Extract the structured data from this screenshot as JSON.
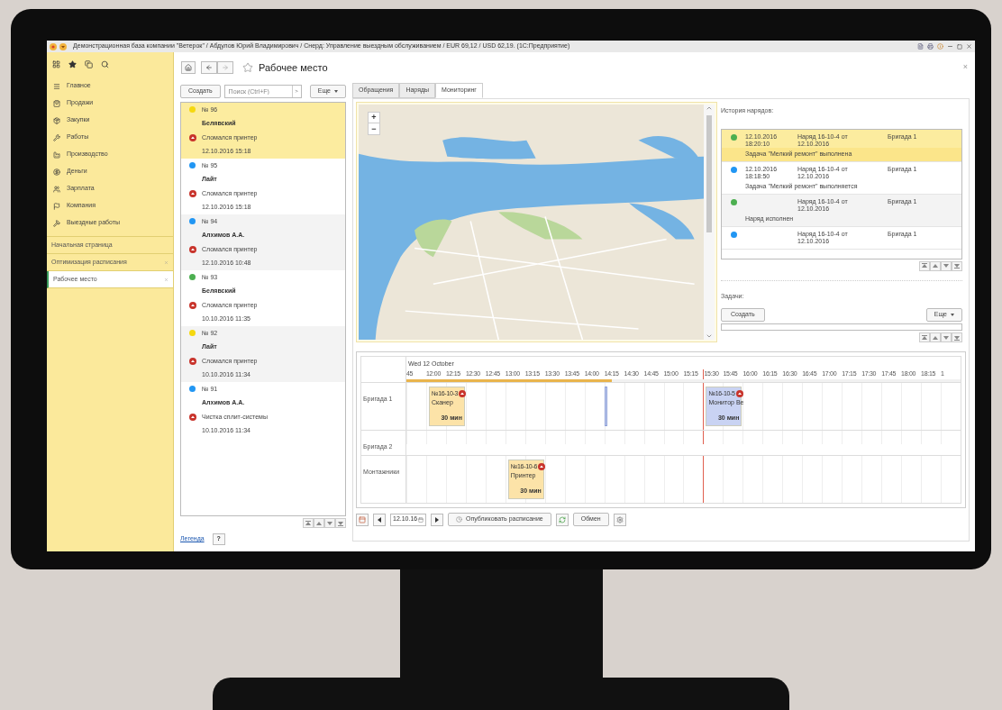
{
  "window": {
    "title": "Демонстрационная база компании \"Ветерок\" / Абдулов Юрий Владимирович / Снерд: Управление выездным обслуживанием / EUR 69,12 / USD 62,19. (1С:Предприятие)"
  },
  "sidebar": {
    "items": [
      {
        "label": "Главное"
      },
      {
        "label": "Продажи"
      },
      {
        "label": "Закупки"
      },
      {
        "label": "Работы"
      },
      {
        "label": "Производство"
      },
      {
        "label": "Деньги"
      },
      {
        "label": "Зарплата"
      },
      {
        "label": "Компания"
      },
      {
        "label": "Выездные работы"
      }
    ],
    "open_pages": [
      {
        "label": "Начальная страница",
        "selected": false,
        "closable": false
      },
      {
        "label": "Оптимизация расписания",
        "selected": false,
        "closable": true
      },
      {
        "label": "Рабочее место",
        "selected": true,
        "closable": true
      }
    ]
  },
  "header": {
    "title": "Рабочее место",
    "close": "×"
  },
  "requests": {
    "create_button": "Создать",
    "search": {
      "placeholder": "Поиск (Ctrl+F)"
    },
    "search_go": ">",
    "more_button": "Еще",
    "items": [
      {
        "number": "№ 96",
        "client": "Белявский",
        "problem": "Сломался принтер",
        "date": "12.10.2016 15:18",
        "color": "#f5d80f",
        "selected": true
      },
      {
        "number": "№ 95",
        "client": "Лайт",
        "problem": "Сломался принтер",
        "date": "12.10.2016 15:18",
        "color": "#2196f3",
        "selected": false
      },
      {
        "number": "№ 94",
        "client": "Алхимов А.А.",
        "problem": "Сломался принтер",
        "date": "12.10.2016 10:48",
        "color": "#2196f3",
        "selected": false
      },
      {
        "number": "№ 93",
        "client": "Белявский",
        "problem": "Сломался принтер",
        "date": "10.10.2016 11:35",
        "color": "#4caf50",
        "selected": false
      },
      {
        "number": "№ 92",
        "client": "Лайт",
        "problem": "Сломался принтер",
        "date": "10.10.2016 11:34",
        "color": "#f5d80f",
        "selected": false
      },
      {
        "number": "№ 91",
        "client": "Алхимов А.А.",
        "problem": "Чистка сплит-системы",
        "date": "10.10.2016 11:34",
        "color": "#2196f3",
        "selected": false
      }
    ],
    "legend_link": "Легенда",
    "help_button": "?"
  },
  "tabs": [
    {
      "label": "Обращения",
      "selected": false
    },
    {
      "label": "Наряды",
      "selected": false
    },
    {
      "label": "Мониторинг",
      "selected": true
    }
  ],
  "map": {
    "zoom_in": "+",
    "zoom_out": "−"
  },
  "history": {
    "label": "История нарядов:",
    "rows": [
      {
        "date": "12.10.2016",
        "time": "18:20:10",
        "order": "Наряд 16-10-4 от",
        "order_date": "12.10.2016",
        "team": "Бригада 1",
        "note": "Задача \"Мелкий ремонт\" выполнена",
        "color": "#4caf50",
        "selected": true
      },
      {
        "date": "12.10.2016",
        "time": "18:18:50",
        "order": "Наряд 16-10-4 от",
        "order_date": "12.10.2016",
        "team": "Бригада 1",
        "note": "Задача \"Мелкий ремонт\" выполняется",
        "color": "#2196f3",
        "selected": false
      },
      {
        "order": "Наряд 16-10-4 от",
        "order_date": "12.10.2016",
        "team": "Бригада 1",
        "note": "Наряд исполнен",
        "color": "#4caf50",
        "selected": false
      },
      {
        "order": "Наряд 16-10-4 от",
        "order_date": "12.10.2016",
        "team": "Бригада 1",
        "color": "#2196f3",
        "selected": false
      }
    ]
  },
  "tasks": {
    "label": "Задачи:",
    "create_button": "Создать",
    "more_button": "Еще"
  },
  "timeline": {
    "date": "Wed 12 October",
    "progress": {
      "level": 0.37
    },
    "ticks": [
      {
        "label": "45",
        "now": false
      },
      {
        "label": "12:00",
        "now": false
      },
      {
        "label": "12:15",
        "now": false
      },
      {
        "label": "12:30",
        "now": false
      },
      {
        "label": "12:45",
        "now": false
      },
      {
        "label": "13:00",
        "now": false
      },
      {
        "label": "13:15",
        "now": false
      },
      {
        "label": "13:30",
        "now": false
      },
      {
        "label": "13:45",
        "now": false
      },
      {
        "label": "14:00",
        "now": false
      },
      {
        "label": "14:15",
        "now": false
      },
      {
        "label": "14:30",
        "now": false
      },
      {
        "label": "14:45",
        "now": false
      },
      {
        "label": "15:00",
        "now": false
      },
      {
        "label": "15:15",
        "now": false
      },
      {
        "label": "15:30",
        "now": true
      },
      {
        "label": "15:45",
        "now": false
      },
      {
        "label": "16:00",
        "now": false
      },
      {
        "label": "16:15",
        "now": false
      },
      {
        "label": "16:30",
        "now": false
      },
      {
        "label": "16:45",
        "now": false
      },
      {
        "label": "17:00",
        "now": false
      },
      {
        "label": "17:15",
        "now": false
      },
      {
        "label": "17:30",
        "now": false
      },
      {
        "label": "17:45",
        "now": false
      },
      {
        "label": "18:00",
        "now": false
      },
      {
        "label": "18:15",
        "now": false
      },
      {
        "label": "1",
        "now": false
      }
    ],
    "rows": [
      {
        "name": "Бригада 1",
        "slots": [
          {
            "kind": "empty"
          },
          {
            "kind": "order",
            "number": "№16-10-3",
            "title": "Сканер",
            "duration": "30 мин",
            "color": "#fce3a8"
          },
          {
            "kind": "empty"
          },
          {
            "kind": "empty"
          },
          {
            "kind": "empty"
          },
          {
            "kind": "empty"
          },
          {
            "kind": "empty"
          },
          {
            "kind": "empty"
          },
          {
            "kind": "empty"
          },
          {
            "kind": "empty"
          },
          {
            "kind": "marker",
            "color": "#c5d0ee"
          },
          {
            "kind": "empty"
          },
          {
            "kind": "empty"
          },
          {
            "kind": "empty"
          },
          {
            "kind": "empty"
          },
          {
            "kind": "order",
            "number": "№16-10-5",
            "title": "Монитор Ве",
            "duration": "30 мин",
            "color": "#c9d3f3"
          }
        ]
      },
      {
        "name": "Бригада 2"
      },
      {
        "name": "Монтажники",
        "slots": [
          {
            "kind": "empty"
          },
          {
            "kind": "empty"
          },
          {
            "kind": "empty"
          },
          {
            "kind": "empty"
          },
          {
            "kind": "empty"
          },
          {
            "kind": "order",
            "number": "№16-10-6",
            "title": "Принтер",
            "duration": "30 мин",
            "color": "#fce3a8"
          }
        ]
      }
    ]
  },
  "toolbar": {
    "date": "12.10.16",
    "publish_button": "Опубликовать расписание",
    "exchange_button": "Обмен"
  }
}
